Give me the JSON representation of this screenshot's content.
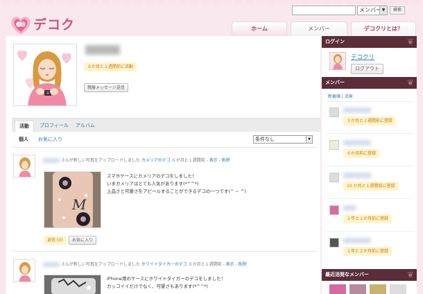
{
  "site": {
    "logo_text": "デコクリ"
  },
  "search": {
    "scope": "メンバー",
    "button": "検索"
  },
  "nav": {
    "home": "ホーム",
    "member": "メンバー",
    "about": "デコクリとは？"
  },
  "profile": {
    "last_login": "６か月と１週間前に活動",
    "message_button": "親展メッセージ送信"
  },
  "tabs": {
    "activity": "活動",
    "profile": "プロフィール",
    "album": "アルバム"
  },
  "subtabs": {
    "personal": "個人",
    "favorites": "お気に入り"
  },
  "filter": {
    "value": "条件なし"
  },
  "feed": [
    {
      "action": "さんが新しい写真をアップロードしました",
      "photo_title": "カメリアのデコ",
      "time": "６か月と１週間前",
      "show": "表示",
      "delete": "削除",
      "lines": [
        "スマホケースにカメリアのデコをしました！",
        "いまカメリアはとても人気があります(*^^*)",
        "上品さと可愛さをアピールすることができるデコの一つです(^ ~ ^)"
      ],
      "comment_btn": "返信 (0)",
      "fav_btn": "お気に入り"
    },
    {
      "action": "さんが新しい写真をアップロードしました",
      "photo_title": "ホワイトタイガーのデコ",
      "time": "６か月と１週間前",
      "show": "表示",
      "delete": "削除",
      "lines": [
        "iPhone用のケースにホワイトタイガーのデコをしました！",
        "カッコイイだけでなく、可愛さもあります(*^^*)"
      ]
    }
  ],
  "sidebar": {
    "login_title": "ログイン",
    "login_user": "デコクリ",
    "logout": "ログアウト",
    "members_title": "メンバー",
    "sort_new": "新着順",
    "sort_sep": " | ",
    "sort_active": "活発",
    "members": [
      {
        "joined": "３か月と１週間前に登録"
      },
      {
        "joined": "６か月前に登録"
      },
      {
        "joined": "10 か月と１週間前に登録"
      },
      {
        "joined": "１年と１か月前に登録"
      },
      {
        "joined": "１年と２か月前に登録"
      }
    ],
    "active_title": "最近活発なメンバー"
  },
  "colors": {
    "accent": "#d2527b",
    "panel": "#5a2d39",
    "link": "#2b7bb9",
    "badge_bg": "#fff4cc"
  }
}
